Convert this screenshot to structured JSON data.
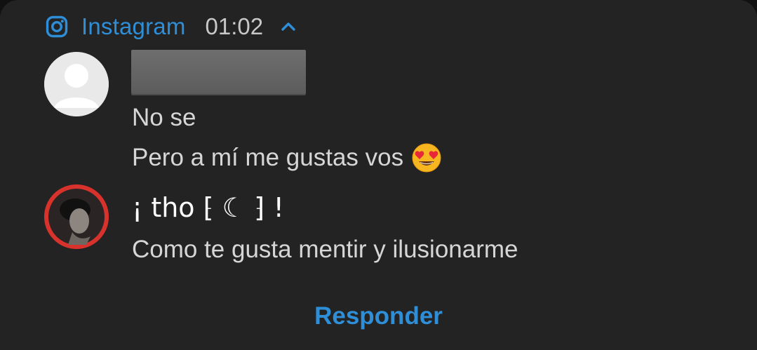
{
  "notification": {
    "app_name": "Instagram",
    "time": "01:02",
    "app_icon": "instagram-icon",
    "expand_icon": "chevron-up-icon"
  },
  "messages": [
    {
      "sender": "",
      "sender_redacted": true,
      "avatar": "default-avatar",
      "lines": [
        "No se",
        "Pero a mí me gustas vos"
      ],
      "emoji": "heart-eyes-emoji"
    },
    {
      "sender": "¡ tho ⁅ ☾ ⁆ !",
      "avatar": "profile-photo",
      "lines": [
        "Como te gusta mentir y ilusionarme"
      ]
    }
  ],
  "actions": {
    "reply_label": "Responder"
  },
  "colors": {
    "accent": "#2e8fd8",
    "background": "#232324",
    "text": "#d6d6d6",
    "avatar_ring": "#d8322c"
  }
}
